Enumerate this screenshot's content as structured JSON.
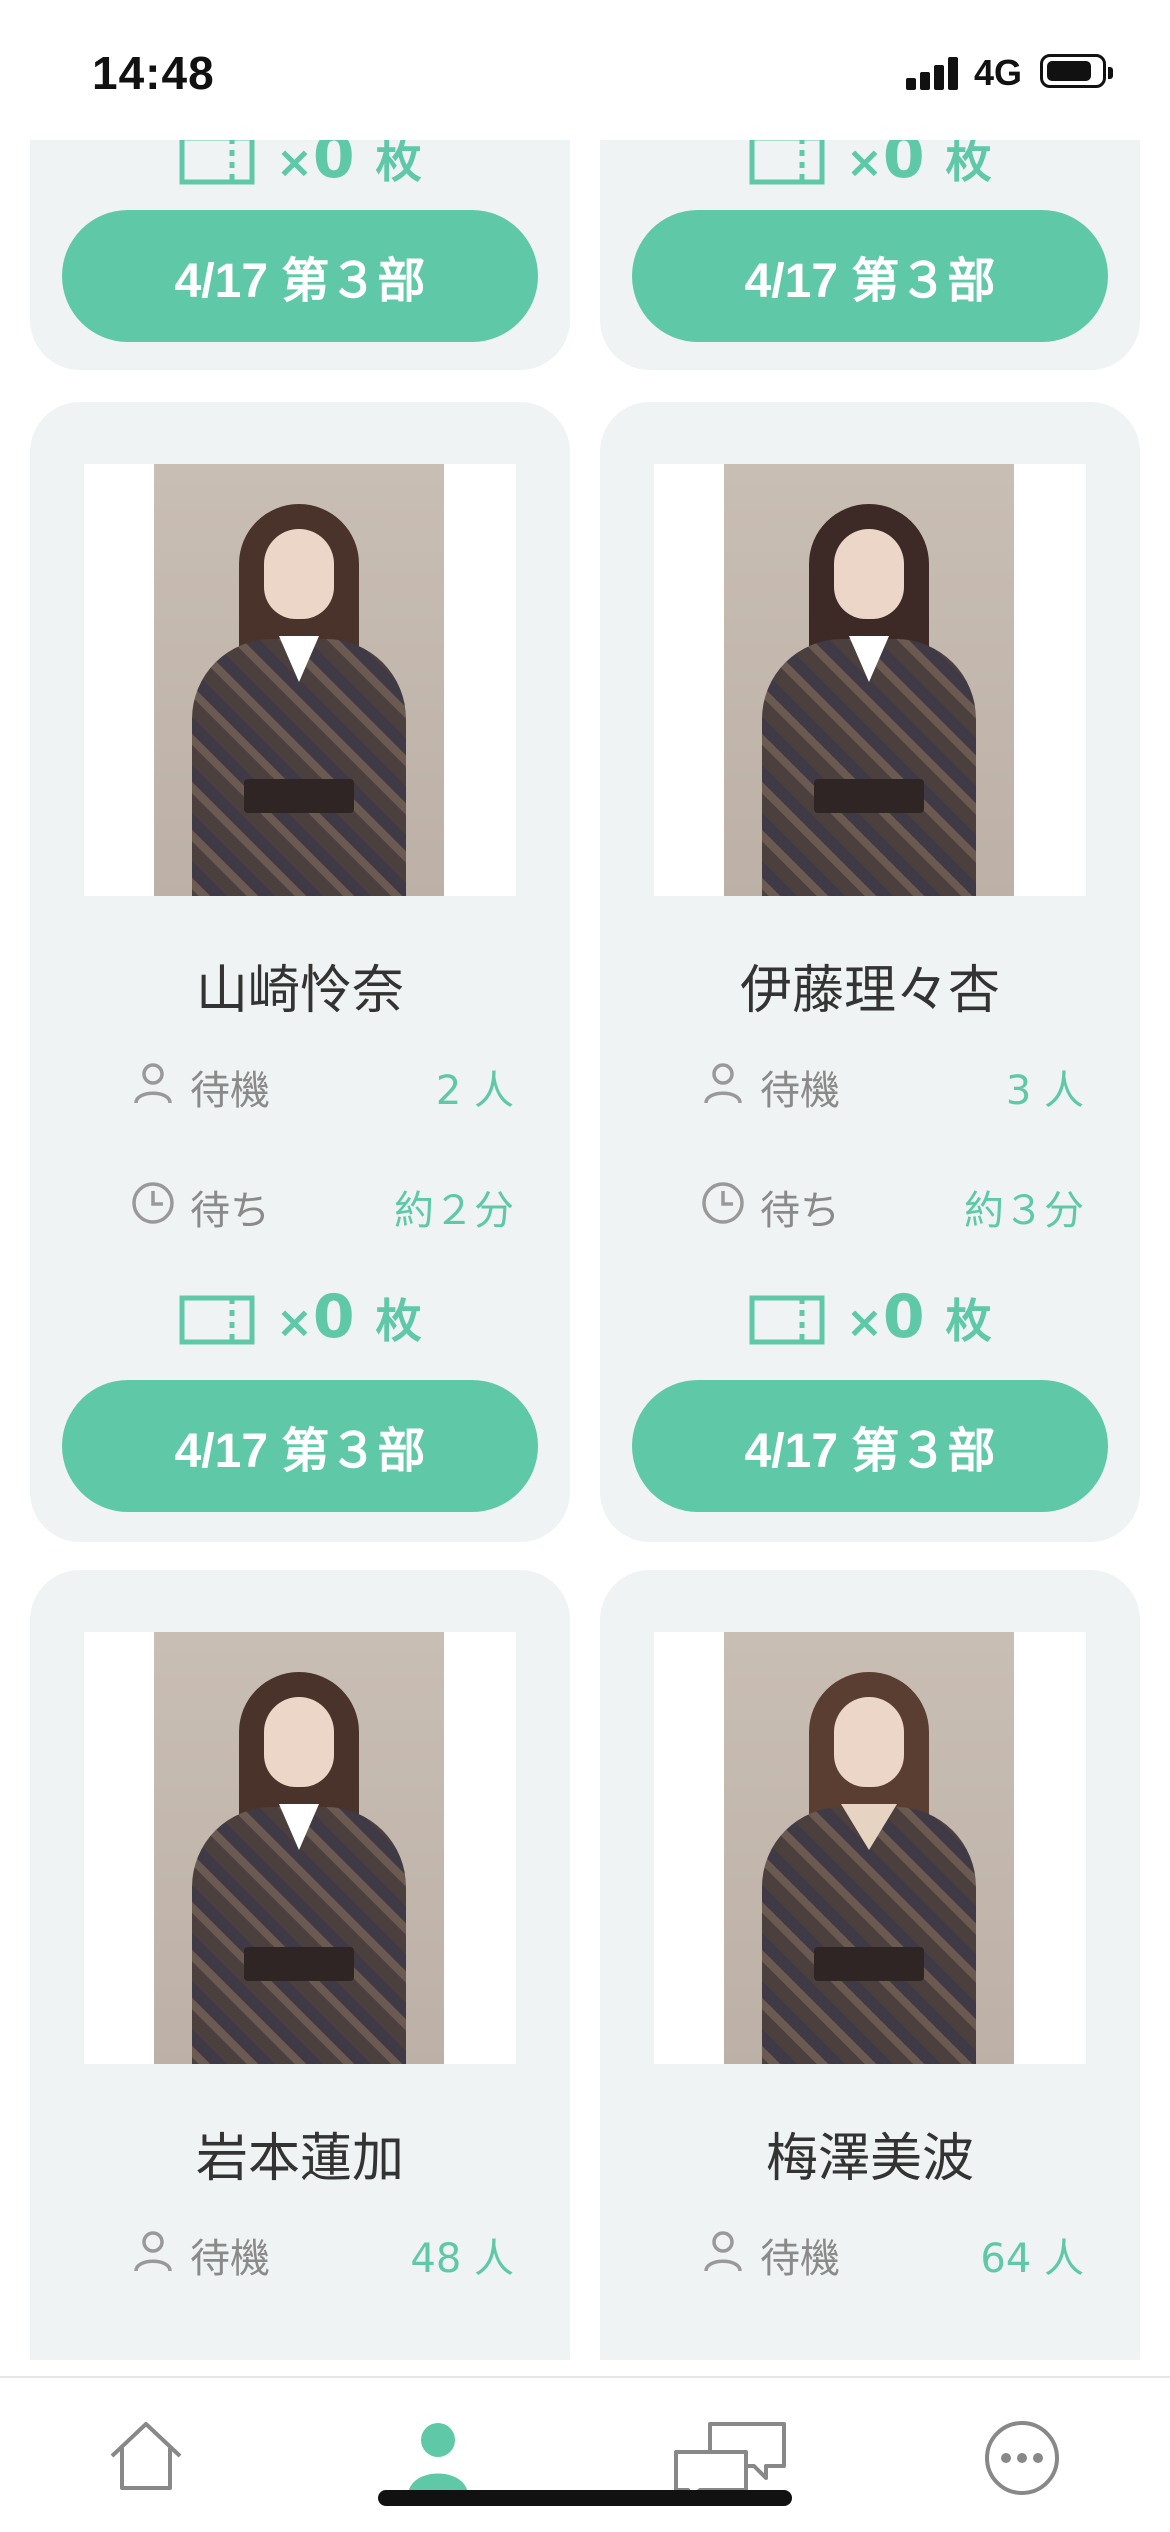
{
  "status_bar": {
    "time": "14:48",
    "network": "4G"
  },
  "colors": {
    "accent": "#5fc8a6",
    "card_bg": "#eff3f3"
  },
  "cards": [
    {
      "session": "4/17 第３部",
      "tickets": {
        "prefix": "×",
        "count": "0",
        "unit": "枚"
      }
    },
    {
      "session": "4/17 第３部",
      "tickets": {
        "prefix": "×",
        "count": "0",
        "unit": "枚"
      }
    },
    {
      "name": "山崎怜奈",
      "wait_label": "待機",
      "wait_value": "2 人",
      "time_label": "待ち",
      "time_value": "約２分",
      "session": "4/17 第３部",
      "tickets": {
        "prefix": "×",
        "count": "0",
        "unit": "枚"
      }
    },
    {
      "name": "伊藤理々杏",
      "wait_label": "待機",
      "wait_value": "3 人",
      "time_label": "待ち",
      "time_value": "約３分",
      "session": "4/17 第３部",
      "tickets": {
        "prefix": "×",
        "count": "0",
        "unit": "枚"
      }
    },
    {
      "name": "岩本蓮加",
      "wait_label": "待機",
      "wait_value": "48 人"
    },
    {
      "name": "梅澤美波",
      "wait_label": "待機",
      "wait_value": "64 人"
    }
  ],
  "tab_bar": {
    "icons": [
      "home-icon",
      "person-icon",
      "chat-bubbles-icon",
      "more-icon"
    ],
    "active_index": 1
  }
}
